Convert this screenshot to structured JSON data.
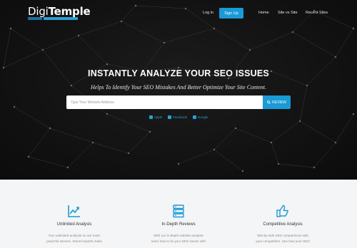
{
  "nav": {
    "logo_prefix": "Digi",
    "logo_suffix": "Temple",
    "login": "Log in",
    "signup": "Sign Up",
    "home": "Home",
    "site_vs_site": "Site vs Site",
    "recent_sites": "Recent Sites"
  },
  "hero": {
    "title": "INSTANTLY ANALYZE YOUR SEO ISSUES",
    "subtitle": "Helps To Identify Your SEO Mistakes And Better Optimize Your Site Content.",
    "search_placeholder": "Type Your Website Address",
    "review_button": "REVIEW",
    "social_links": [
      "Apple",
      "Facebook",
      "Google"
    ]
  },
  "features": [
    {
      "title": "Unlimited Analysis",
      "desc": "Run unlimited analysis on our most\npowerful servers. Stored reports make",
      "icon": "trend-chart-icon"
    },
    {
      "title": "In-Depth Reviews",
      "desc": "With our in-depth website analysis\nlearn how to fix your SEO issues with",
      "icon": "server-stack-icon"
    },
    {
      "title": "Competitive Analysis",
      "desc": "Site-by-side SEO comparisons with\nyour competitors. See how your SEO",
      "icon": "thumbs-up-icon"
    }
  ],
  "colors": {
    "accent": "#1a9ad6",
    "hero_bg": "#141414",
    "section_bg": "#f4f5f6"
  }
}
